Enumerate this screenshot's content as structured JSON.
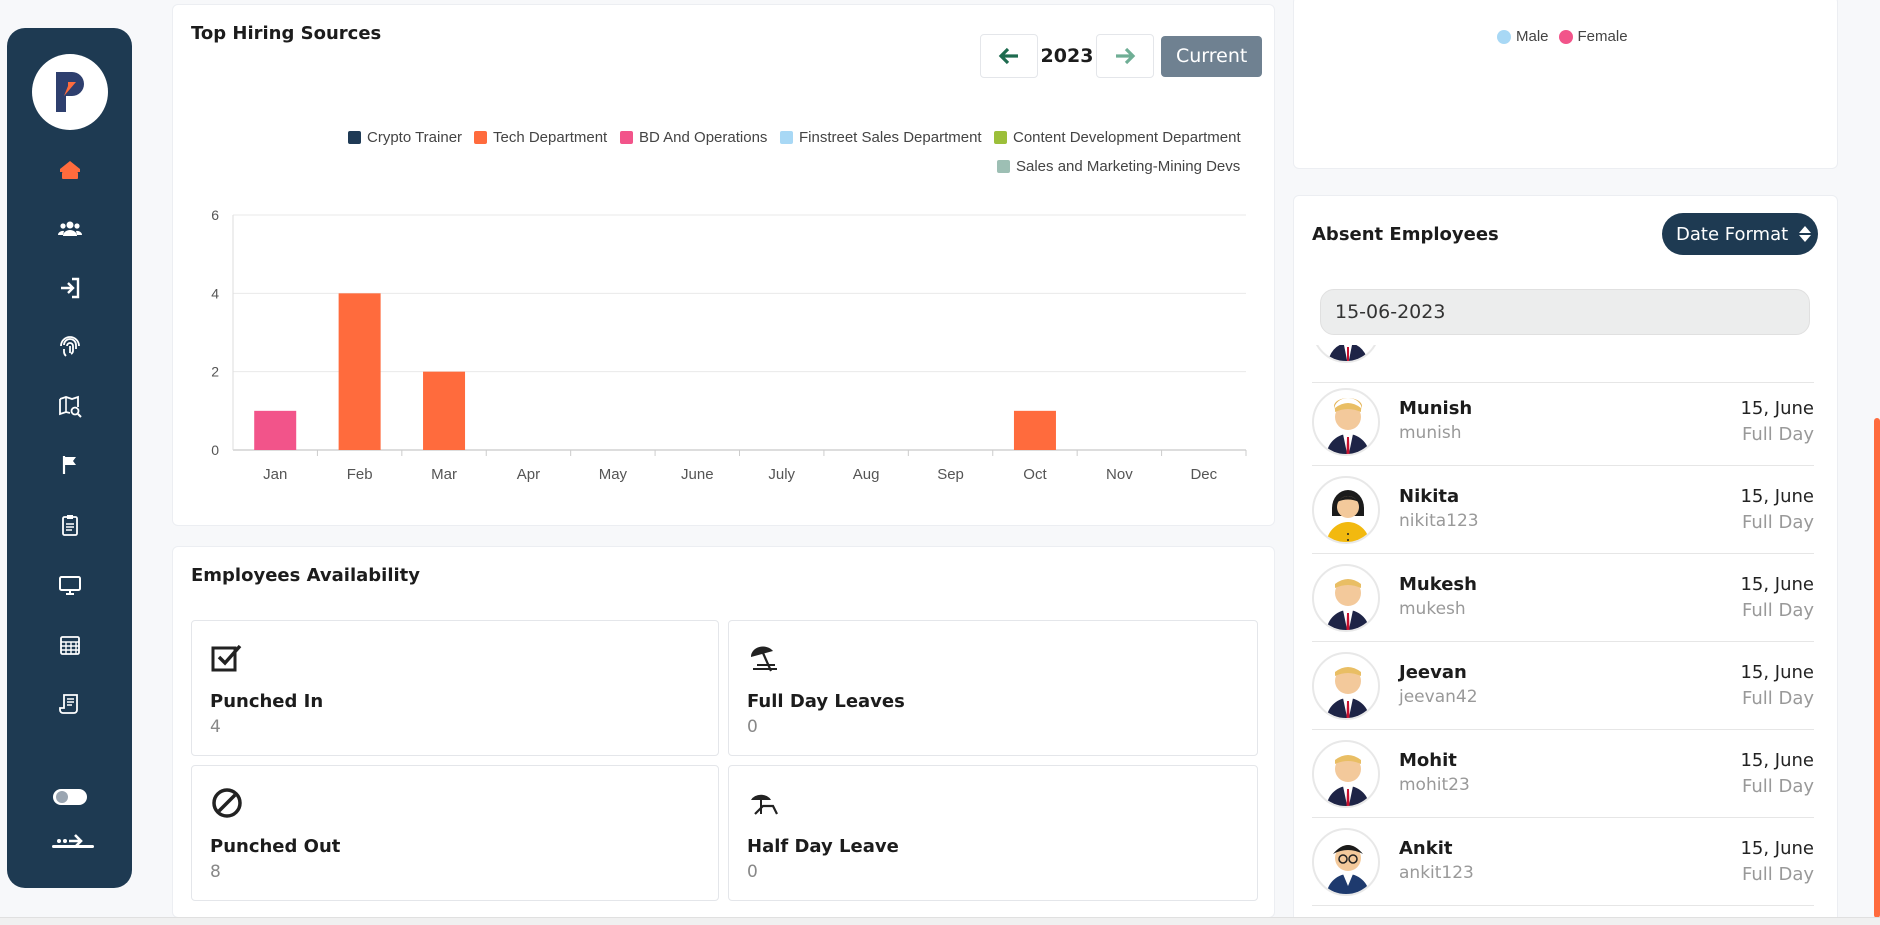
{
  "hiring": {
    "title": "Top Hiring Sources",
    "year": "2023",
    "current_label": "Current"
  },
  "chart_data": {
    "type": "bar",
    "title": "Top Hiring Sources",
    "categories": [
      "Jan",
      "Feb",
      "Mar",
      "Apr",
      "May",
      "June",
      "July",
      "Aug",
      "Sep",
      "Oct",
      "Nov",
      "Dec"
    ],
    "series": [
      {
        "name": "Crypto Trainer",
        "color": "#1f3a55",
        "values": [
          0,
          0,
          0,
          0,
          0,
          0,
          0,
          0,
          0,
          0,
          0,
          0
        ]
      },
      {
        "name": "Tech Department",
        "color": "#ff6b3d",
        "values": [
          0,
          4,
          2,
          0,
          0,
          0,
          0,
          0,
          0,
          1,
          0,
          0
        ]
      },
      {
        "name": "BD And Operations",
        "color": "#f2548a",
        "values": [
          1,
          0,
          0,
          0,
          0,
          0,
          0,
          0,
          0,
          0,
          0,
          0
        ]
      },
      {
        "name": "Finstreet Sales Department",
        "color": "#a8d8f5",
        "values": [
          0,
          0,
          0,
          0,
          0,
          0,
          0,
          0,
          0,
          0,
          0,
          0
        ]
      },
      {
        "name": "Content Development Department",
        "color": "#9cbf3a",
        "values": [
          0,
          0,
          0,
          0,
          0,
          0,
          0,
          0,
          0,
          0,
          0,
          0
        ]
      },
      {
        "name": "Sales and Marketing-Mining Devs",
        "color": "#9dbfb4",
        "values": [
          0,
          0,
          0,
          0,
          0,
          0,
          0,
          0,
          0,
          0,
          0,
          0
        ]
      }
    ],
    "yticks": [
      "0",
      "2",
      "4",
      "6"
    ],
    "ylim": [
      0,
      6
    ],
    "grid": true,
    "legend_position": "top-right"
  },
  "availability": {
    "title": "Employees Availability",
    "items": [
      {
        "label": "Punched In",
        "value": "4"
      },
      {
        "label": "Full Day Leaves",
        "value": "0"
      },
      {
        "label": "Punched Out",
        "value": "8"
      },
      {
        "label": "Half Day Leave",
        "value": "0"
      }
    ]
  },
  "gender_legend": {
    "male": "Male",
    "female": "Female",
    "male_color": "#a8d8f5",
    "female_color": "#f2548a"
  },
  "absent": {
    "title": "Absent Employees",
    "date_format_label": "Date Format",
    "date_value": "15-06-2023",
    "partial_type": "Full Day",
    "employees": [
      {
        "name": "Munish",
        "username": "munish",
        "date": "15, June",
        "type": "Full Day"
      },
      {
        "name": "Nikita",
        "username": "nikita123",
        "date": "15, June",
        "type": "Full Day"
      },
      {
        "name": "Mukesh",
        "username": "mukesh",
        "date": "15, June",
        "type": "Full Day"
      },
      {
        "name": "Jeevan",
        "username": "jeevan42",
        "date": "15, June",
        "type": "Full Day"
      },
      {
        "name": "Mohit",
        "username": "mohit23",
        "date": "15, June",
        "type": "Full Day"
      },
      {
        "name": "Ankit",
        "username": "ankit123",
        "date": "15, June",
        "type": "Full Day"
      }
    ]
  },
  "sidebar": {
    "icons": [
      "home-icon",
      "team-icon",
      "login-icon",
      "fingerprint-icon",
      "map-search-icon",
      "flag-icon",
      "clipboard-icon",
      "monitor-icon",
      "calendar-icon",
      "receipt-icon",
      "toggle-icon",
      "logout-icon"
    ],
    "accent": "#ff6b3d",
    "background": "#1e3a52"
  }
}
